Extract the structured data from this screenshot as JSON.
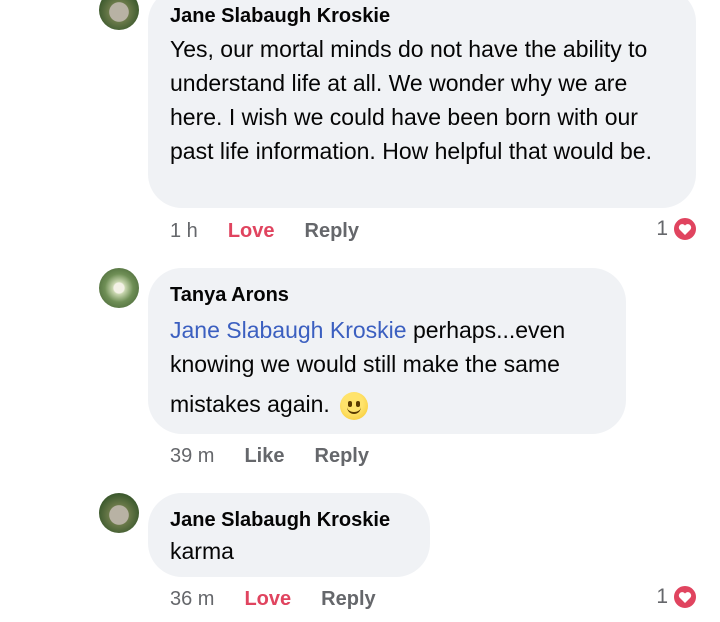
{
  "comments": [
    {
      "author": "Jane Slabaugh Kroskie",
      "text": "Yes, our mortal minds do not  have the ability to understand life at all.  We wonder why we are here.  I wish we could have been born with our past life information.  How helpful that would be.",
      "time": "1 h",
      "react_label": "Love",
      "reply_label": "Reply",
      "reaction_count": "1"
    },
    {
      "author": "Tanya Arons",
      "mention": "Jane Slabaugh Kroskie",
      "text_line1_rest": " perhaps...even",
      "text_line2": "knowing we would still make the same",
      "text_line3": "mistakes again.",
      "time": "39 m",
      "react_label": "Like",
      "reply_label": "Reply"
    },
    {
      "author": "Jane Slabaugh Kroskie",
      "text": "karma",
      "time": "36 m",
      "react_label": "Love",
      "reply_label": "Reply",
      "reaction_count": "1"
    }
  ],
  "colors": {
    "love": "#e0445f",
    "mention": "#3b5fc0",
    "bubble": "#f0f2f5",
    "meta": "#65676b"
  }
}
